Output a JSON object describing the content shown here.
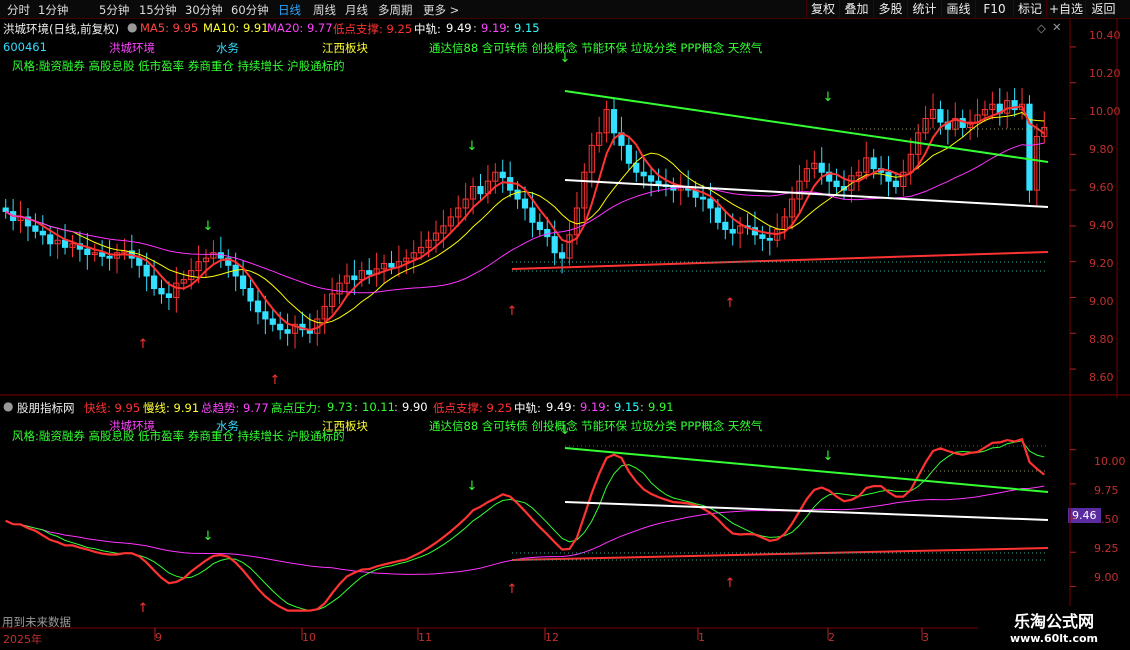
{
  "tabs": [
    "分时",
    "1分钟",
    "5分钟",
    "15分钟",
    "30分钟",
    "60分钟",
    "日线",
    "周线",
    "月线",
    "多周期",
    "更多 >"
  ],
  "active_tab": "日线",
  "right_buttons": [
    "复权",
    "叠加",
    "多股",
    "统计",
    "画线",
    "F10",
    "标记",
    "+自选",
    "返回"
  ],
  "main": {
    "title": "洪城环境(日线,前复权)",
    "ma5": "MA5: 9.95",
    "ma10": "MA10: 9.91",
    "ma20": "MA20: 9.77",
    "low_support": "低点支撑: 9.25",
    "mid_label": "中轨:",
    "mid_values": [
      "9.49",
      "9.19",
      "9.15"
    ],
    "code": "600461",
    "name": "洪城环境",
    "industry": "水务",
    "region": "江西板块",
    "concepts": "通达信88 含可转债 创投概念 节能环保 垃圾分类 PPP概念 天然气",
    "style": "风格:融资融券 高股息股 低市盈率 券商重仓 持续增长 沪股通标的",
    "axis": [
      "10.40",
      "10.20",
      "10.00",
      "9.80",
      "9.60",
      "9.40",
      "9.20",
      "9.00",
      "8.80",
      "8.60"
    ]
  },
  "indicator": {
    "title": "股朋指标网",
    "fast": "快线: 9.95",
    "slow": "慢线: 9.91",
    "trend": "总趋势: 9.77",
    "pressure_label": "高点压力:",
    "pressure_values": [
      "9.73",
      "10.11",
      "9.90"
    ],
    "low_support": "低点支撑: 9.25",
    "mid_label": "中轨:",
    "mid_values": [
      "9.49",
      "9.19",
      "9.15",
      "9.91"
    ],
    "name": "洪城环境",
    "industry": "水务",
    "region": "江西板块",
    "concepts": "通达信88 含可转债 创投概念 节能环保 垃圾分类 PPP概念 天然气",
    "style": "风格:融资融券 高股息股 低市盈率 券商重仓 持续增长 沪股通标的",
    "axis": [
      "10.00",
      "9.75",
      "9.50",
      "9.25",
      "9.00"
    ],
    "current_badge": "9.46",
    "future_note": "用到未来数据"
  },
  "date_axis": [
    "2025年",
    "9",
    "10",
    "11",
    "12",
    "1",
    "2",
    "3"
  ],
  "watermark": {
    "line1": "乐淘公式网",
    "line2": "www.60lt.com"
  },
  "colors": {
    "up": "#ff3333",
    "down": "#33e0ff",
    "ma5": "#ffffff",
    "ma10": "#ffff00",
    "ma20": "#ff33ff",
    "green": "#33ff33"
  },
  "chart_data": {
    "type": "candlestick",
    "close": [
      9.48,
      9.43,
      9.45,
      9.4,
      9.37,
      9.35,
      9.3,
      9.32,
      9.28,
      9.3,
      9.27,
      9.24,
      9.25,
      9.23,
      9.22,
      9.25,
      9.26,
      9.22,
      9.18,
      9.12,
      9.05,
      9.02,
      9.0,
      9.08,
      9.1,
      9.15,
      9.2,
      9.22,
      9.25,
      9.22,
      9.18,
      9.12,
      9.05,
      8.98,
      8.92,
      8.88,
      8.85,
      8.82,
      8.8,
      8.85,
      8.82,
      8.8,
      8.88,
      8.95,
      9.02,
      9.08,
      9.12,
      9.1,
      9.15,
      9.13,
      9.16,
      9.19,
      9.17,
      9.2,
      9.22,
      9.25,
      9.28,
      9.32,
      9.36,
      9.4,
      9.45,
      9.5,
      9.55,
      9.62,
      9.58,
      9.65,
      9.7,
      9.67,
      9.6,
      9.55,
      9.5,
      9.42,
      9.38,
      9.34,
      9.25,
      9.22,
      9.35,
      9.5,
      9.7,
      9.85,
      9.92,
      10.05,
      9.92,
      9.85,
      9.75,
      9.7,
      9.68,
      9.65,
      9.63,
      9.62,
      9.6,
      9.62,
      9.6,
      9.56,
      9.55,
      9.5,
      9.42,
      9.38,
      9.36,
      9.4,
      9.39,
      9.35,
      9.33,
      9.32,
      9.38,
      9.45,
      9.55,
      9.65,
      9.72,
      9.75,
      9.7,
      9.65,
      9.62,
      9.6,
      9.68,
      9.7,
      9.78,
      9.72,
      9.7,
      9.65,
      9.62,
      9.7,
      9.8,
      9.92,
      10.0,
      10.05,
      9.98,
      9.94,
      10.0,
      9.95,
      9.98,
      10.02,
      10.05,
      10.08,
      10.03,
      10.1,
      10.05,
      10.08,
      9.6,
      9.9,
      9.95
    ],
    "ylim_main": [
      8.55,
      10.45
    ],
    "ylim_indicator": [
      8.93,
      10.1
    ]
  }
}
